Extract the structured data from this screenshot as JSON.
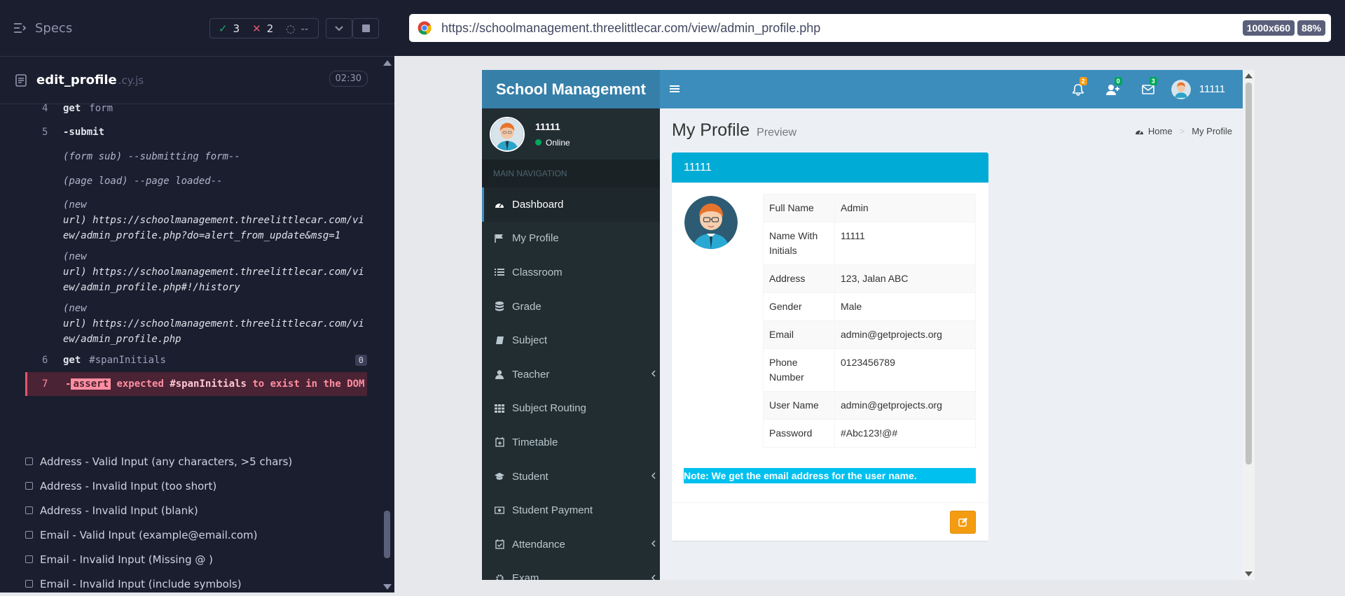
{
  "runner": {
    "specs_label": "Specs",
    "passed": "3",
    "failed": "2",
    "pending": "--",
    "spec_name": "edit_profile",
    "spec_ext": ".cy.js",
    "duration": "02:30",
    "commands": [
      {
        "ln": "4",
        "kw": "get",
        "arg": "form"
      },
      {
        "ln": "5",
        "kw": "-submit",
        "arg": ""
      },
      {
        "ln": "",
        "text": "(form sub)  --submitting form--"
      },
      {
        "ln": "",
        "text": "(page load)  --page loaded--"
      },
      {
        "ln": "",
        "label": "(new",
        "text": "url)  https://schoolmanagement.threelittlecar.com/view/admin_profile.php?do=alert_from_update&msg=1"
      },
      {
        "ln": "",
        "label": "(new",
        "text": "url)  https://schoolmanagement.threelittlecar.com/view/admin_profile.php#!/history"
      },
      {
        "ln": "",
        "label": "(new",
        "text": "url)  https://schoolmanagement.threelittlecar.com/view/admin_profile.php"
      },
      {
        "ln": "6",
        "kw": "get",
        "arg": "#spanInitials",
        "count": "0"
      }
    ],
    "failure": {
      "ln": "7",
      "prefix": "-",
      "badge": "assert",
      "msg_a": "expected",
      "selector": "#spanInitials",
      "msg_b": "to exist in the DOM"
    },
    "tests": [
      "Address - Valid Input (any characters, >5 chars)",
      "Address - Invalid Input (too short)",
      "Address - Invalid Input (blank)",
      "Email - Valid Input (example@email.com)",
      "Email - Invalid Input (Missing @ )",
      "Email - Invalid Input (include symbols)"
    ]
  },
  "browser": {
    "url": "https://schoolmanagement.threelittlecar.com/view/admin_profile.php",
    "viewport": "1000x660",
    "zoom": "88%"
  },
  "app": {
    "logo": "School Management",
    "notif_counts": {
      "bell": "2",
      "users": "0",
      "mail": "3"
    },
    "badge_colors": {
      "bell": "#f39c12",
      "users": "#00a65a",
      "mail": "#00a65a"
    },
    "header_user": "11111",
    "sidebar_user": "11111",
    "sidebar_status": "Online",
    "nav_header": "MAIN NAVIGATION",
    "menu": [
      {
        "label": "Dashboard",
        "icon": "dashboard-icon",
        "active": true
      },
      {
        "label": "My Profile",
        "icon": "flag-icon"
      },
      {
        "label": "Classroom",
        "icon": "list-icon"
      },
      {
        "label": "Grade",
        "icon": "database-icon"
      },
      {
        "label": "Subject",
        "icon": "book-icon"
      },
      {
        "label": "Teacher",
        "icon": "user-icon",
        "expand": true
      },
      {
        "label": "Subject Routing",
        "icon": "grid-icon"
      },
      {
        "label": "Timetable",
        "icon": "calendar-plus-icon"
      },
      {
        "label": "Student",
        "icon": "graduation-cap-icon",
        "expand": true
      },
      {
        "label": "Student Payment",
        "icon": "money-icon"
      },
      {
        "label": "Attendance",
        "icon": "calendar-check-icon",
        "expand": true
      },
      {
        "label": "Exam",
        "icon": "cog-icon",
        "expand": true
      }
    ],
    "page_title": "My Profile",
    "page_subtitle": "Preview",
    "breadcrumb": {
      "home": "Home",
      "sep": ">",
      "current": "My Profile"
    },
    "box_title": "11111",
    "profile": [
      {
        "k": "Full Name",
        "v": "Admin"
      },
      {
        "k": "Name With Initials",
        "v": "11111"
      },
      {
        "k": "Address",
        "v": "123, Jalan ABC"
      },
      {
        "k": "Gender",
        "v": "Male"
      },
      {
        "k": "Email",
        "v": "admin@getprojects.org"
      },
      {
        "k": "Phone Number",
        "v": "0123456789"
      },
      {
        "k": "User Name",
        "v": "admin@getprojects.org"
      },
      {
        "k": "Password",
        "v": "#Abc123!@#"
      }
    ],
    "note": "Note: We get the email address for the user name."
  }
}
